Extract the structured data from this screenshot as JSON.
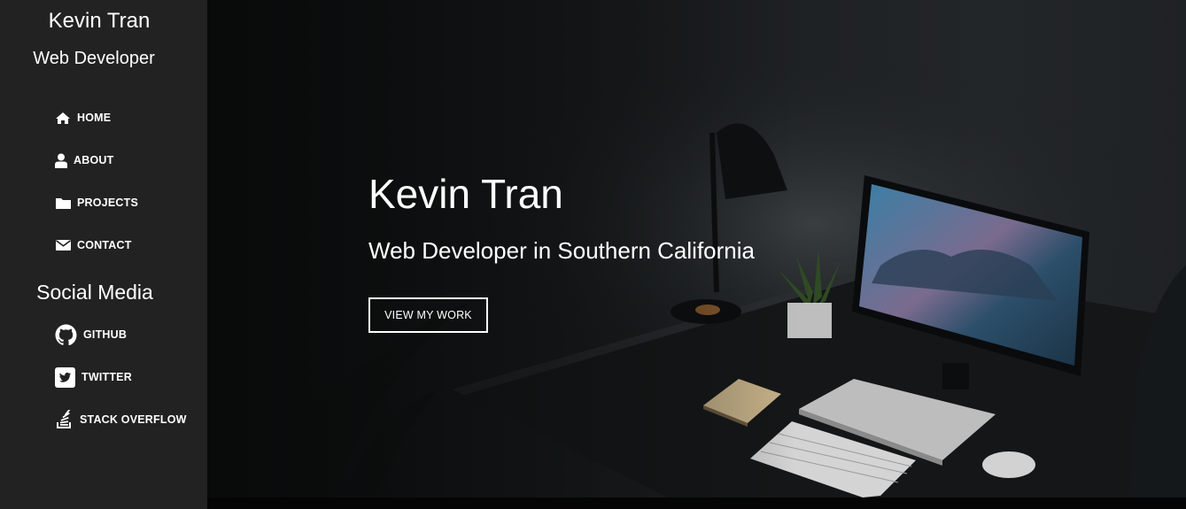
{
  "sidebar": {
    "name": "Kevin Tran",
    "role": "Web Developer",
    "nav": [
      {
        "label": "HOME",
        "icon": "home-icon"
      },
      {
        "label": "ABOUT",
        "icon": "user-icon"
      },
      {
        "label": "PROJECTS",
        "icon": "folder-icon"
      },
      {
        "label": "CONTACT",
        "icon": "envelope-icon"
      }
    ],
    "social_heading": "Social Media",
    "social": [
      {
        "label": "GITHUB",
        "icon": "github-icon"
      },
      {
        "label": "TWITTER",
        "icon": "twitter-icon"
      },
      {
        "label": "STACK OVERFLOW",
        "icon": "stack-overflow-icon"
      }
    ]
  },
  "hero": {
    "title": "Kevin Tran",
    "subtitle": "Web Developer in Southern California",
    "button_label": "VIEW MY WORK"
  },
  "colors": {
    "sidebar_bg": "#222222",
    "hero_bg": "#1d2022",
    "text": "#ffffff"
  }
}
